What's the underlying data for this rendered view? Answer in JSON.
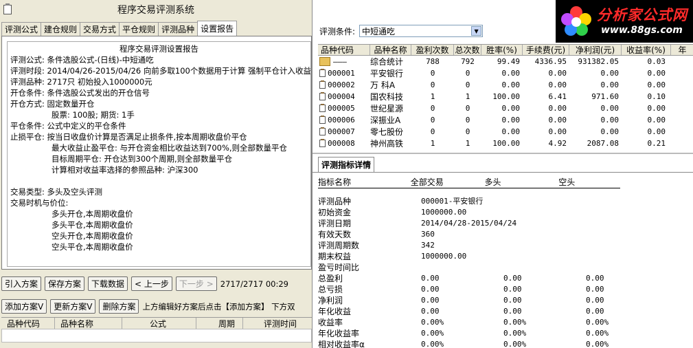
{
  "window": {
    "title": "程序交易评测系统"
  },
  "tabs": [
    "评测公式",
    "建仓规则",
    "交易方式",
    "平仓规则",
    "评测品种",
    "设置报告"
  ],
  "report": {
    "title": "程序交易评测设置报告",
    "lines": [
      "评测公式: 条件选股公式-(日线)-中短通吃",
      "评测时段: 2014/04/26-2015/04/26 向前多取100个数据用于计算 强制平仓计入收益",
      "评测品种: 2717只 初始投入1000000元",
      "开仓条件: 条件选股公式发出的开仓信号",
      "开仓方式: 固定数量开仓",
      "股票: 100股; 期货: 1手",
      "平仓条件: 公式中定义的平仓条件",
      "止损平仓: 按当日收盘价计算是否满足止损条件,按本周期收盘价平仓",
      "最大收益止盈平仓: 与开仓资金相比收益达到700%,则全部数量平仓",
      "目标周期平仓: 开仓达到300个周期,则全部数量平仓",
      "计算相对收益率选择的参照品种: 沪深300",
      "",
      "交易类型: 多头及空头评测",
      "交易时机与价位:",
      "多头开仓,本周期收盘价",
      "多头平仓,本周期收盘价",
      "空头开仓,本周期收盘价",
      "空头平仓,本周期收盘价"
    ]
  },
  "toolbar1": {
    "import": "引入方案",
    "save": "保存方案",
    "download": "下载数据",
    "prev": "< 上一步",
    "next": "下一步 >",
    "status": "2717/2717 00:29"
  },
  "toolbar2": {
    "add": "添加方案V",
    "update": "更新方案V",
    "delete": "删除方案",
    "hint": "上方编辑好方案后点击【添加方案】 下方双"
  },
  "left_grid": {
    "headers": [
      "品种代码",
      "品种名称",
      "公式",
      "周期",
      "评测时间"
    ]
  },
  "right": {
    "cond_label": "评测条件:",
    "cond_value": "中短通吃",
    "logo_brand": "分析家公式网",
    "logo_url": "www.88gs.com",
    "headers": [
      "品种代码",
      "品种名称",
      "盈利次数",
      "总次数",
      "胜率(%)",
      "手续费(元)",
      "净利润(元)",
      "收益率(%)",
      "年"
    ],
    "rows": [
      {
        "code": "———",
        "name": "综合统计",
        "win": "788",
        "total": "792",
        "rate": "99.49",
        "fee": "4336.95",
        "profit": "931382.05",
        "ret": "0.03",
        "type": "folder"
      },
      {
        "code": "000001",
        "name": "平安银行",
        "win": "0",
        "total": "0",
        "rate": "0.00",
        "fee": "0.00",
        "profit": "0.00",
        "ret": "0.00",
        "type": "stock"
      },
      {
        "code": "000002",
        "name": "万 科A",
        "win": "0",
        "total": "0",
        "rate": "0.00",
        "fee": "0.00",
        "profit": "0.00",
        "ret": "0.00",
        "type": "stock"
      },
      {
        "code": "000004",
        "name": "国农科技",
        "win": "1",
        "total": "1",
        "rate": "100.00",
        "fee": "6.41",
        "profit": "971.60",
        "ret": "0.10",
        "type": "stock"
      },
      {
        "code": "000005",
        "name": "世纪星源",
        "win": "0",
        "total": "0",
        "rate": "0.00",
        "fee": "0.00",
        "profit": "0.00",
        "ret": "0.00",
        "type": "stock"
      },
      {
        "code": "000006",
        "name": "深振业A",
        "win": "0",
        "total": "0",
        "rate": "0.00",
        "fee": "0.00",
        "profit": "0.00",
        "ret": "0.00",
        "type": "stock"
      },
      {
        "code": "000007",
        "name": "零七股份",
        "win": "0",
        "total": "0",
        "rate": "0.00",
        "fee": "0.00",
        "profit": "0.00",
        "ret": "0.00",
        "type": "stock"
      },
      {
        "code": "000008",
        "name": "神州高铁",
        "win": "1",
        "total": "1",
        "rate": "100.00",
        "fee": "4.92",
        "profit": "2087.08",
        "ret": "0.21",
        "type": "stock"
      }
    ],
    "detail_tab": "评测指标详情",
    "detail_headers": [
      "指标名称",
      "全部交易",
      "多头",
      "空头"
    ],
    "detail_info": [
      {
        "k": "评测品种",
        "v": "000001-平安银行"
      },
      {
        "k": "初始资金",
        "v": "1000000.00"
      },
      {
        "k": "评测日期",
        "v": "2014/04/28-2015/04/24"
      },
      {
        "k": "有效天数",
        "v": "360"
      },
      {
        "k": "评测周期数",
        "v": "342"
      },
      {
        "k": "期末权益",
        "v": "1000000.00"
      }
    ],
    "detail_stats": [
      {
        "k": "盈亏时间比",
        "a": "",
        "l": "",
        "s": ""
      },
      {
        "k": "总盈利",
        "a": "0.00",
        "l": "0.00",
        "s": "0.00"
      },
      {
        "k": "总亏损",
        "a": "0.00",
        "l": "0.00",
        "s": "0.00"
      },
      {
        "k": "净利润",
        "a": "0.00",
        "l": "0.00",
        "s": "0.00"
      },
      {
        "k": "年化收益",
        "a": "0.00",
        "l": "0.00",
        "s": "0.00"
      },
      {
        "k": "收益率",
        "a": "0.00%",
        "l": "0.00%",
        "s": "0.00%"
      },
      {
        "k": "年化收益率",
        "a": "0.00%",
        "l": "0.00%",
        "s": "0.00%"
      },
      {
        "k": "相对收益率α",
        "a": "0.00%",
        "l": "0.00%",
        "s": "0.00%"
      }
    ]
  }
}
